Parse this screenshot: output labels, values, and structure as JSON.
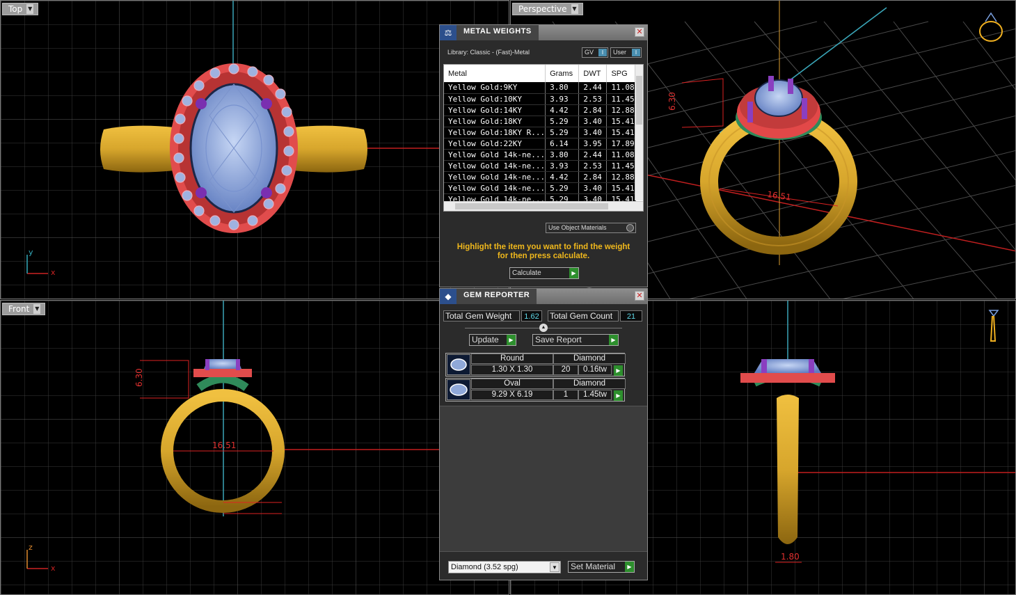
{
  "viewports": {
    "top": {
      "label": "Top"
    },
    "perspective": {
      "label": "Perspective"
    },
    "front": {
      "label": "Front"
    }
  },
  "dimensions": {
    "top_height": "6.30",
    "ring_size": "16.51",
    "front_height": "6.30",
    "front_ring": "16.51",
    "shank_width": "1.80"
  },
  "axes": {
    "x": "x",
    "y": "y",
    "z": "z"
  },
  "metal_weights": {
    "title": "METAL WEIGHTS",
    "library": "Library: Classic - (Fast)-Metal",
    "toggle_gv": "GV",
    "toggle_user": "User",
    "columns": [
      "Metal",
      "Grams",
      "DWT",
      "SPG"
    ],
    "rows": [
      [
        "Yellow Gold:9KY",
        "3.80",
        "2.44",
        "11.08"
      ],
      [
        "Yellow Gold:10KY",
        "3.93",
        "2.53",
        "11.45"
      ],
      [
        "Yellow Gold:14KY",
        "4.42",
        "2.84",
        "12.88"
      ],
      [
        "Yellow Gold:18KY",
        "5.29",
        "3.40",
        "15.41"
      ],
      [
        "Yellow Gold:18KY R...",
        "5.29",
        "3.40",
        "15.41"
      ],
      [
        "Yellow Gold:22KY",
        "6.14",
        "3.95",
        "17.89"
      ],
      [
        "Yellow Gold 14k-ne...",
        "3.80",
        "2.44",
        "11.08"
      ],
      [
        "Yellow Gold 14k-ne...",
        "3.93",
        "2.53",
        "11.45"
      ],
      [
        "Yellow Gold 14k-ne...",
        "4.42",
        "2.84",
        "12.88"
      ],
      [
        "Yellow Gold 14k-ne...",
        "5.29",
        "3.40",
        "15.41"
      ],
      [
        "Yellow Gold 14k-ne...",
        "5.29",
        "3.40",
        "15.41"
      ]
    ],
    "use_object_materials": "Use Object Materials",
    "hint_line1": "Highlight the item you want to find the weight",
    "hint_line2": "for then press calculate.",
    "calculate": "Calculate"
  },
  "gem_reporter": {
    "title": "GEM REPORTER",
    "total_weight_label": "Total Gem Weight",
    "total_weight": "1.62",
    "total_count_label": "Total Gem Count",
    "total_count": "21",
    "update": "Update",
    "save_report": "Save Report",
    "gems": [
      {
        "shape": "Round",
        "material": "Diamond",
        "size": "1.30 X 1.30",
        "count": "20",
        "weight": "0.16tw"
      },
      {
        "shape": "Oval",
        "material": "Diamond",
        "size": "9.29 X 6.19",
        "count": "1",
        "weight": "1.45tw"
      }
    ],
    "material_select": "Diamond     (3.52 spg)",
    "set_material": "Set Material"
  },
  "colors": {
    "gold": "#d8a830",
    "halo": "#e04848",
    "gem": "#8fa8d8",
    "prong": "#8a3fc0",
    "hint": "#f0b81c",
    "green": "#2d8f2d"
  }
}
